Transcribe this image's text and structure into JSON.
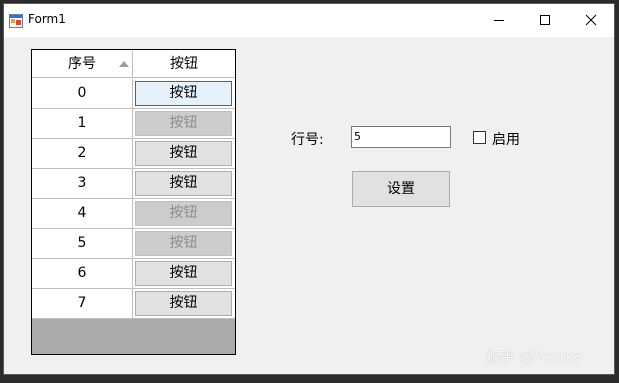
{
  "window": {
    "title": "Form1"
  },
  "grid": {
    "headers": [
      "序号",
      "按钮"
    ],
    "rows": [
      {
        "index": "0",
        "button": "按钮",
        "state": "focused"
      },
      {
        "index": "1",
        "button": "按钮",
        "state": "disabled"
      },
      {
        "index": "2",
        "button": "按钮",
        "state": "enabled"
      },
      {
        "index": "3",
        "button": "按钮",
        "state": "enabled"
      },
      {
        "index": "4",
        "button": "按钮",
        "state": "disabled"
      },
      {
        "index": "5",
        "button": "按钮",
        "state": "disabled"
      },
      {
        "index": "6",
        "button": "按钮",
        "state": "enabled"
      },
      {
        "index": "7",
        "button": "按钮",
        "state": "enabled"
      }
    ]
  },
  "form": {
    "row_label": "行号:",
    "row_value": "5",
    "enable_label": "启用",
    "enable_checked": false,
    "set_button": "设置"
  },
  "watermark": "知乎 @YxHxY",
  "colors": {
    "button_bg": "#e1e1e1",
    "disabled_bg": "#cccccc",
    "focus_border": "#0078d7",
    "grid_bg": "#ababab"
  }
}
